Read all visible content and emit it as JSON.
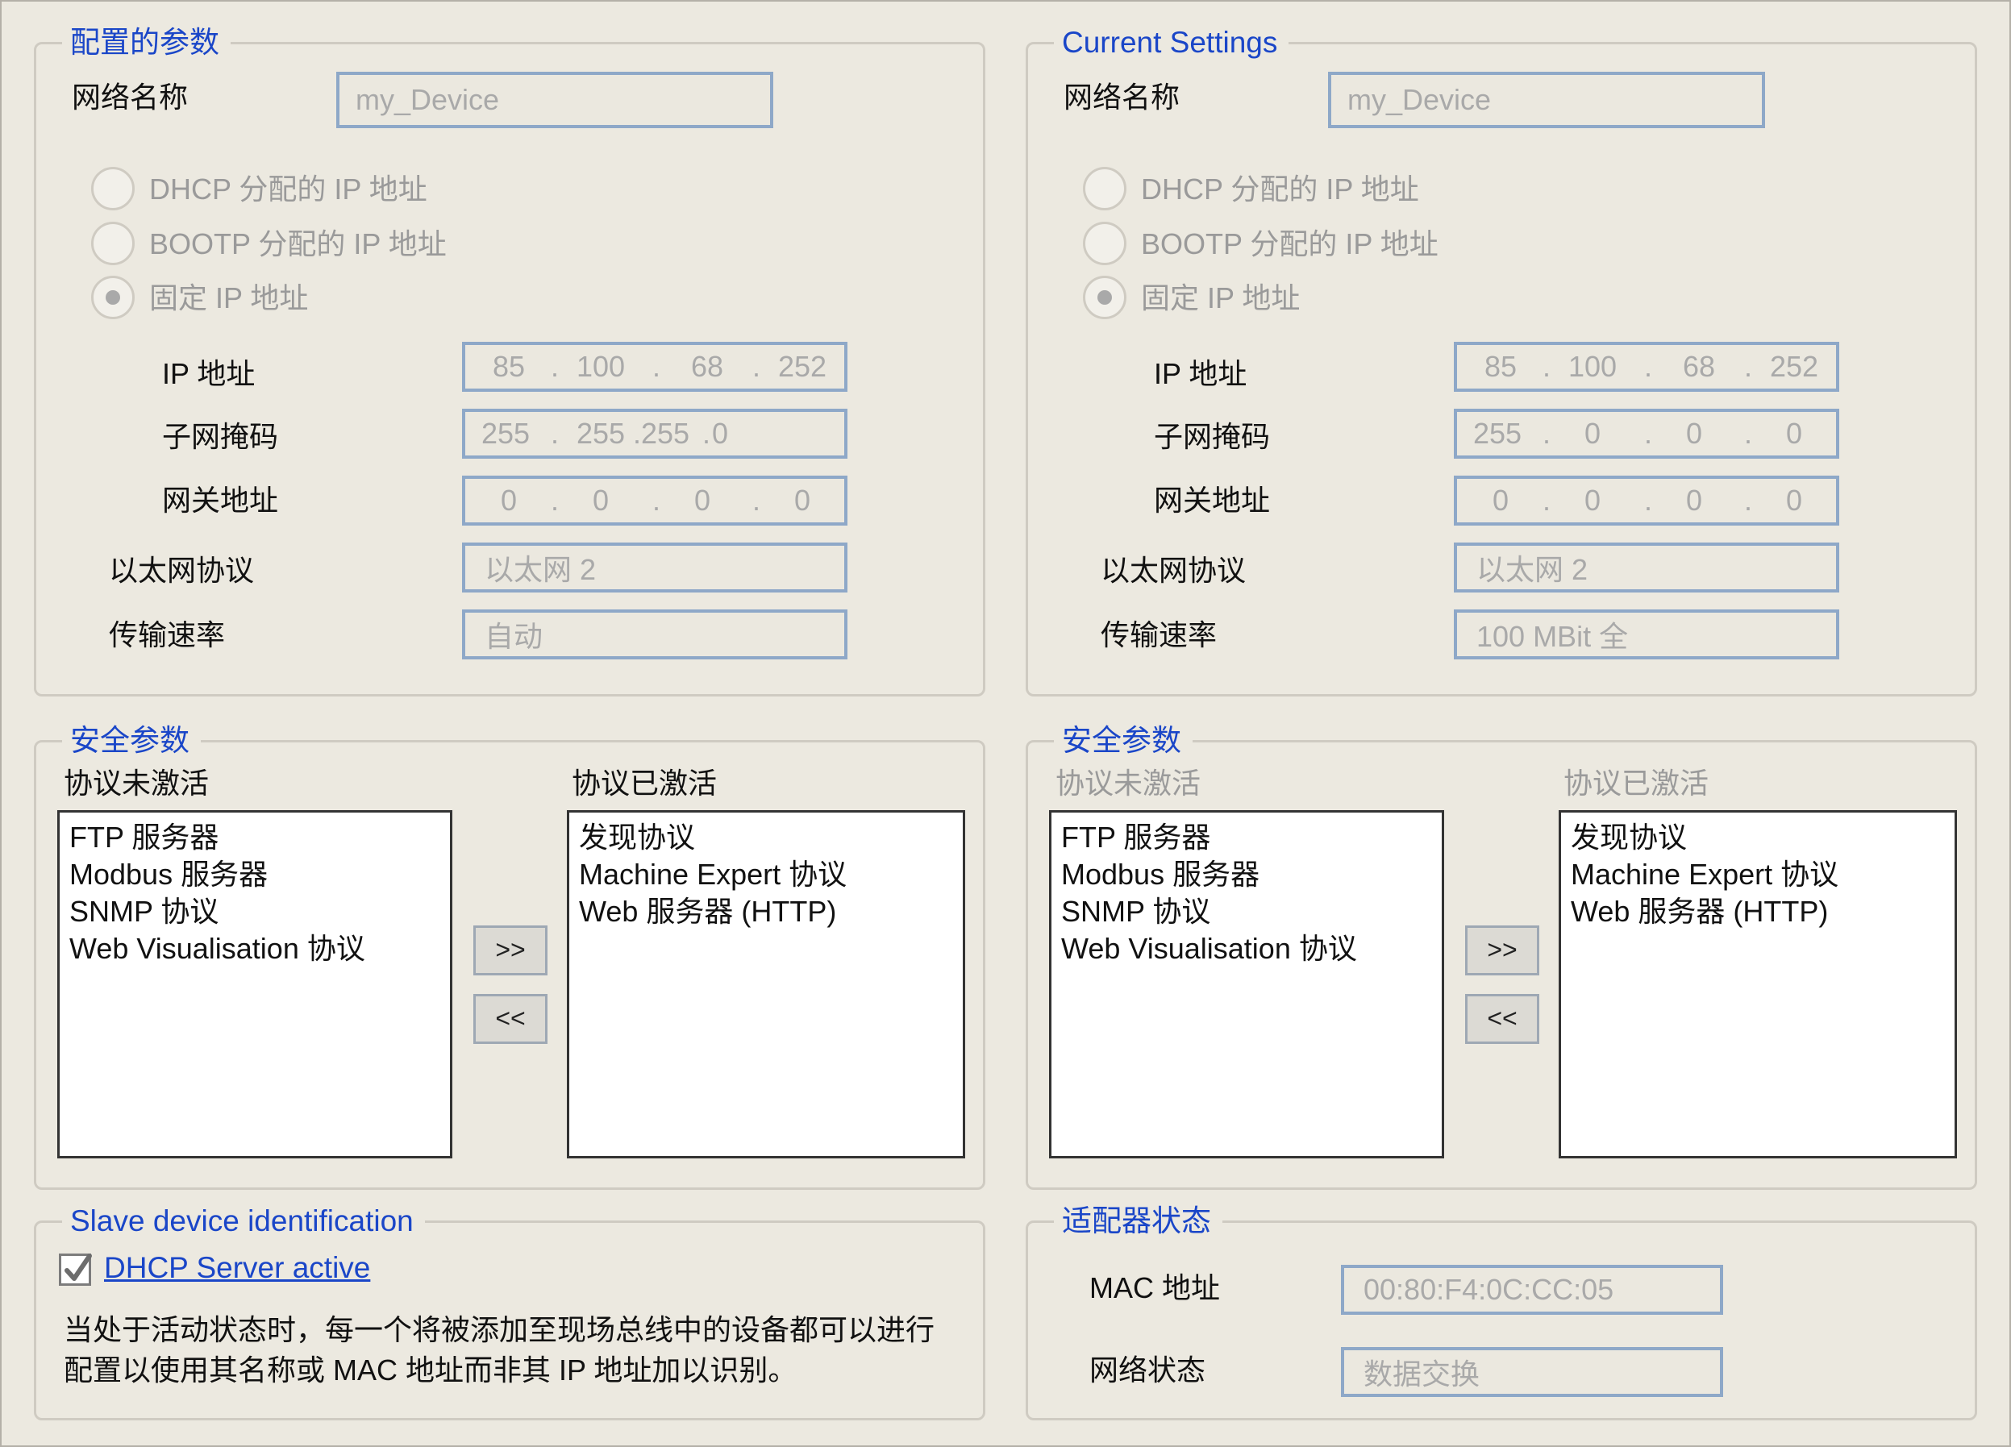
{
  "left": {
    "config": {
      "legend": "配置的参数",
      "network_name": {
        "label": "网络名称",
        "value": "my_Device"
      },
      "radios": [
        {
          "label": "DHCP 分配的 IP 地址",
          "selected": false
        },
        {
          "label": "BOOTP 分配的 IP 地址",
          "selected": false
        },
        {
          "label": "固定 IP 地址",
          "selected": true
        }
      ],
      "ip": {
        "label": "IP 地址",
        "o1": "85",
        "o2": "100",
        "o3": "68",
        "o4": "252",
        "s1": ".",
        "s2": ".",
        "s3": "."
      },
      "mask": {
        "label": "子网掩码",
        "o1": "255",
        "o2": "255",
        "o3": "255",
        "o4": "0",
        "s1": ".",
        "s2": "",
        "s3": "."
      },
      "gateway": {
        "label": "网关地址",
        "o1": "0",
        "o2": "0",
        "o3": "0",
        "o4": "0",
        "s1": ".",
        "s2": ".",
        "s3": "."
      },
      "ethernet": {
        "label": "以太网协议",
        "value": "以太网 2"
      },
      "speed": {
        "label": "传输速率",
        "value": "自动"
      }
    },
    "security": {
      "legend": "安全参数",
      "inactive_label": "协议未激活",
      "active_label": "协议已激活",
      "inactive_items": [
        "FTP 服务器",
        "Modbus 服务器",
        "SNMP 协议",
        "Web Visualisation 协议"
      ],
      "active_items": [
        "发现协议",
        "Machine Expert 协议",
        "Web 服务器 (HTTP)"
      ],
      "add_button": ">>",
      "remove_button": "<<"
    },
    "slave": {
      "legend": "Slave device identification",
      "checkbox_label": "DHCP Server active",
      "checked": true,
      "description_line1": "当处于活动状态时，每一个将被添加至现场总线中的设备都可以进行",
      "description_line2": "配置以使用其名称或 MAC 地址而非其 IP 地址加以识别。"
    }
  },
  "right": {
    "current": {
      "legend": "Current Settings",
      "network_name": {
        "label": "网络名称",
        "value": "my_Device"
      },
      "radios": [
        {
          "label": "DHCP 分配的 IP 地址",
          "selected": false
        },
        {
          "label": "BOOTP 分配的 IP 地址",
          "selected": false
        },
        {
          "label": "固定 IP 地址",
          "selected": true
        }
      ],
      "ip": {
        "label": "IP 地址",
        "o1": "85",
        "o2": "100",
        "o3": "68",
        "o4": "252",
        "s1": ".",
        "s2": ".",
        "s3": "."
      },
      "mask": {
        "label": "子网掩码",
        "o1": "255",
        "o2": "0",
        "o3": "0",
        "o4": "0",
        "s1": ".",
        "s2": ".",
        "s3": "."
      },
      "gateway": {
        "label": "网关地址",
        "o1": "0",
        "o2": "0",
        "o3": "0",
        "o4": "0",
        "s1": ".",
        "s2": ".",
        "s3": "."
      },
      "ethernet": {
        "label": "以太网协议",
        "value": "以太网 2"
      },
      "speed": {
        "label": "传输速率",
        "value": "100 MBit 全"
      }
    },
    "security": {
      "legend": "安全参数",
      "inactive_label": "协议未激活",
      "active_label": "协议已激活",
      "inactive_items": [
        "FTP 服务器",
        "Modbus 服务器",
        "SNMP 协议",
        "Web Visualisation 协议"
      ],
      "active_items": [
        "发现协议",
        "Machine Expert 协议",
        "Web 服务器 (HTTP)"
      ],
      "add_button": ">>",
      "remove_button": "<<"
    },
    "adapter": {
      "legend": "适配器状态",
      "mac": {
        "label": "MAC 地址",
        "value": "00:80:F4:0C:CC:05"
      },
      "net_status": {
        "label": "网络状态",
        "value": "数据交换"
      }
    }
  },
  "colors": {
    "background": "#ece9e0",
    "legend_text": "#1a46c8",
    "field_border": "#8ea8c8",
    "disabled_text": "#a9a9a9"
  }
}
